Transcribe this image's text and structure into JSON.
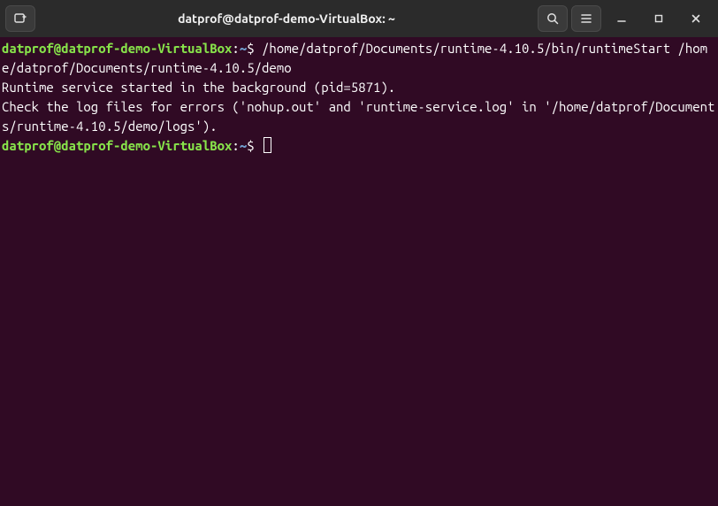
{
  "titlebar": {
    "title": "datprof@datprof-demo-VirtualBox: ~"
  },
  "terminal": {
    "prompts": [
      {
        "userhost": "datprof@datprof-demo-VirtualBox",
        "sep": ":",
        "path": "~",
        "dollar": "$",
        "command": "/home/datprof/Documents/runtime-4.10.5/bin/runtimeStart /home/datprof/Documents/runtime-4.10.5/demo"
      },
      {
        "userhost": "datprof@datprof-demo-VirtualBox",
        "sep": ":",
        "path": "~",
        "dollar": "$",
        "command": ""
      }
    ],
    "output": [
      "Runtime service started in the background (pid=5871).",
      "Check the log files for errors ('nohup.out' and 'runtime-service.log' in '/home/datprof/Documents/runtime-4.10.5/demo/logs')."
    ]
  }
}
